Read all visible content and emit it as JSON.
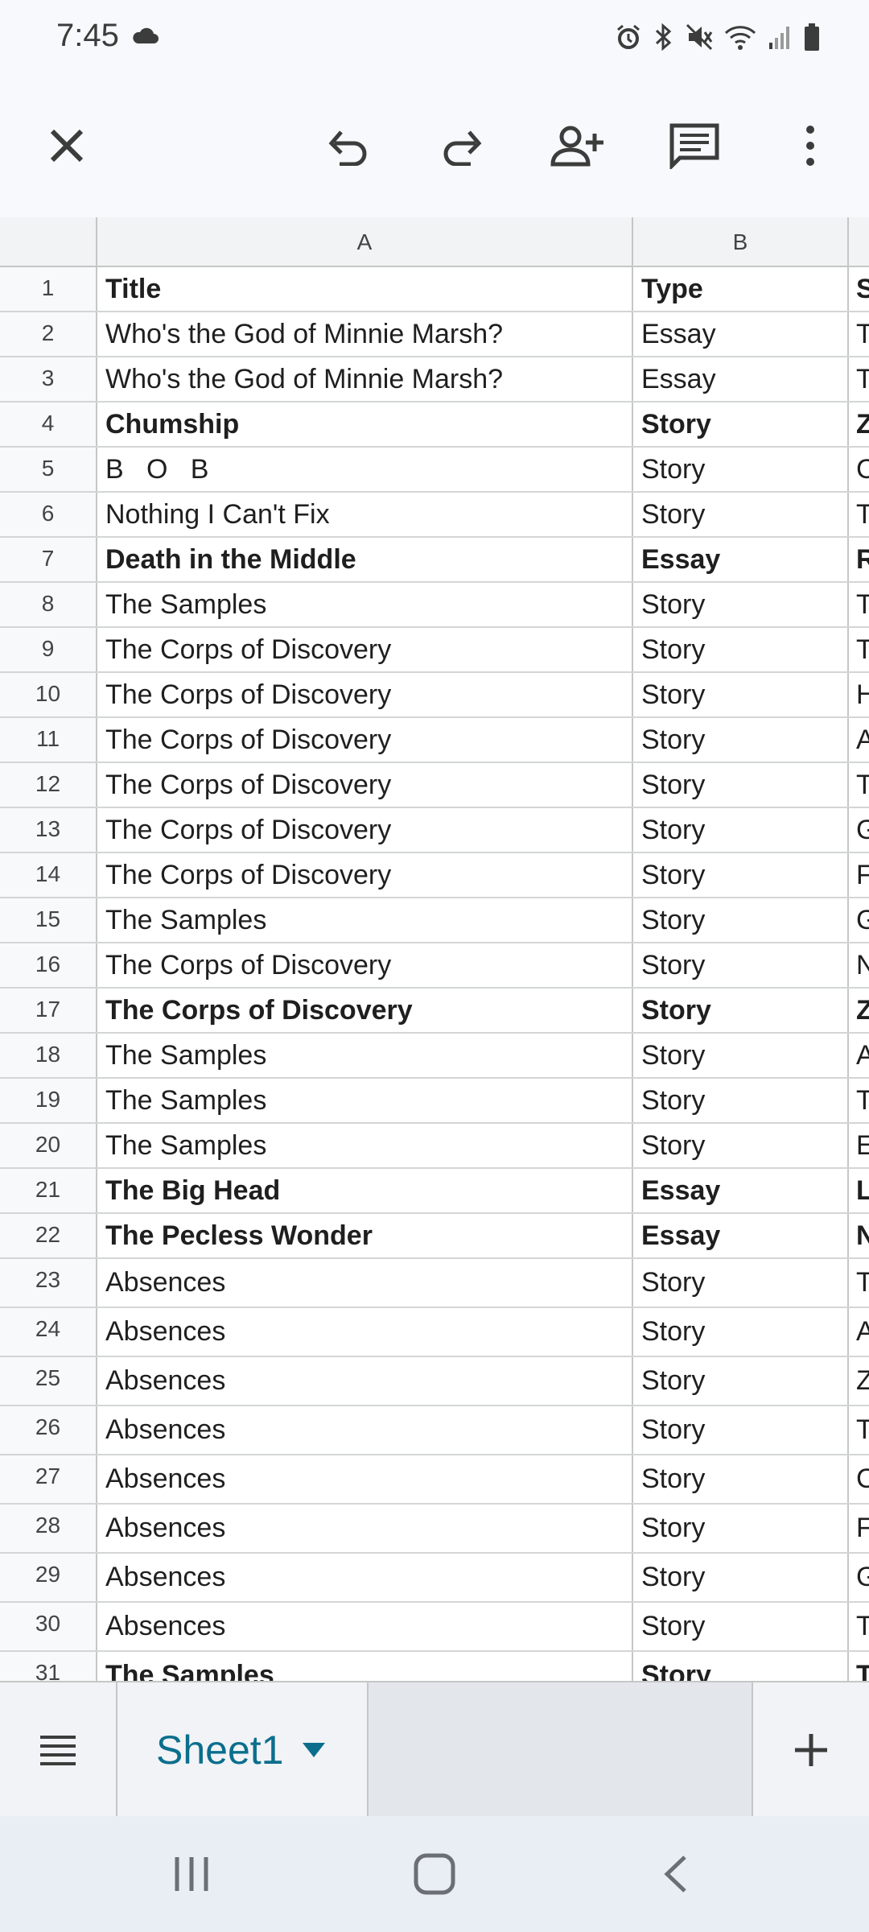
{
  "status_bar": {
    "time": "7:45",
    "icons": [
      "cloud-icon",
      "alarm-icon",
      "bluetooth-icon",
      "mute-icon",
      "wifi-icon",
      "signal-icon",
      "battery-icon"
    ]
  },
  "toolbar": {
    "buttons": [
      "close-icon",
      "undo-icon",
      "redo-icon",
      "share-person-icon",
      "comment-icon",
      "more-vert-icon"
    ]
  },
  "sheet": {
    "columns": [
      "A",
      "B"
    ],
    "rows": [
      {
        "n": "1",
        "a": "Title",
        "b": "Type",
        "c": "S",
        "bold": true
      },
      {
        "n": "2",
        "a": "Who's the God of Minnie Marsh?",
        "b": "Essay",
        "c": "T",
        "bold": false
      },
      {
        "n": "3",
        "a": "Who's the God of Minnie Marsh?",
        "b": "Essay",
        "c": "T",
        "bold": false
      },
      {
        "n": "4",
        "a": "Chumship",
        "b": "Story",
        "c": "Z",
        "bold": true
      },
      {
        "n": "5",
        "a": "B   O   B",
        "b": "Story",
        "c": "C",
        "bold": false
      },
      {
        "n": "6",
        "a": "Nothing I Can't Fix",
        "b": "Story",
        "c": "T",
        "bold": false
      },
      {
        "n": "7",
        "a": "Death in the Middle",
        "b": "Essay",
        "c": "R",
        "bold": true
      },
      {
        "n": "8",
        "a": "The Samples",
        "b": "Story",
        "c": "T",
        "bold": false
      },
      {
        "n": "9",
        "a": "The Corps of Discovery",
        "b": "Story",
        "c": "T",
        "bold": false
      },
      {
        "n": "10",
        "a": "The Corps of Discovery",
        "b": "Story",
        "c": "H",
        "bold": false
      },
      {
        "n": "11",
        "a": "The Corps of Discovery",
        "b": "Story",
        "c": "A",
        "bold": false
      },
      {
        "n": "12",
        "a": "The Corps of Discovery",
        "b": "Story",
        "c": "T",
        "bold": false
      },
      {
        "n": "13",
        "a": "The Corps of Discovery",
        "b": "Story",
        "c": "G",
        "bold": false
      },
      {
        "n": "14",
        "a": "The Corps of Discovery",
        "b": "Story",
        "c": "F",
        "bold": false
      },
      {
        "n": "15",
        "a": "The Samples",
        "b": "Story",
        "c": "G",
        "bold": false
      },
      {
        "n": "16",
        "a": "The Corps of Discovery",
        "b": "Story",
        "c": "N",
        "bold": false
      },
      {
        "n": "17",
        "a": "The Corps of Discovery",
        "b": "Story",
        "c": "Z",
        "bold": true
      },
      {
        "n": "18",
        "a": "The Samples",
        "b": "Story",
        "c": "A",
        "bold": false
      },
      {
        "n": "19",
        "a": "The Samples",
        "b": "Story",
        "c": "T",
        "bold": false
      },
      {
        "n": "20",
        "a": "The Samples",
        "b": "Story",
        "c": "E",
        "bold": false
      },
      {
        "n": "21",
        "a": "The Big Head",
        "b": "Essay",
        "c": "L",
        "bold": true
      },
      {
        "n": "22",
        "a": "The Pecless Wonder",
        "b": "Essay",
        "c": "N",
        "bold": true
      },
      {
        "n": "23",
        "a": "Absences",
        "b": "Story",
        "c": "T",
        "bold": false
      },
      {
        "n": "24",
        "a": "Absences",
        "b": "Story",
        "c": "A",
        "bold": false
      },
      {
        "n": "25",
        "a": "Absences",
        "b": "Story",
        "c": "Z",
        "bold": false
      },
      {
        "n": "26",
        "a": "Absences",
        "b": "Story",
        "c": "T",
        "bold": false
      },
      {
        "n": "27",
        "a": "Absences",
        "b": "Story",
        "c": "C",
        "bold": false
      },
      {
        "n": "28",
        "a": "Absences",
        "b": "Story",
        "c": "F",
        "bold": false
      },
      {
        "n": "29",
        "a": "Absences",
        "b": "Story",
        "c": "G",
        "bold": false
      },
      {
        "n": "30",
        "a": "Absences",
        "b": "Story",
        "c": "T",
        "bold": false
      },
      {
        "n": "31",
        "a": "The Samples",
        "b": "Story",
        "c": "T",
        "bold": true
      }
    ]
  },
  "sheet_tabs": {
    "active_tab": "Sheet1"
  },
  "nav_bar": {
    "buttons": [
      "recents-icon",
      "home-icon",
      "back-icon"
    ]
  },
  "colors": {
    "accent": "#0b6e8c",
    "grid_line": "#c4c7c5",
    "header_bg": "#f1f3f4"
  }
}
